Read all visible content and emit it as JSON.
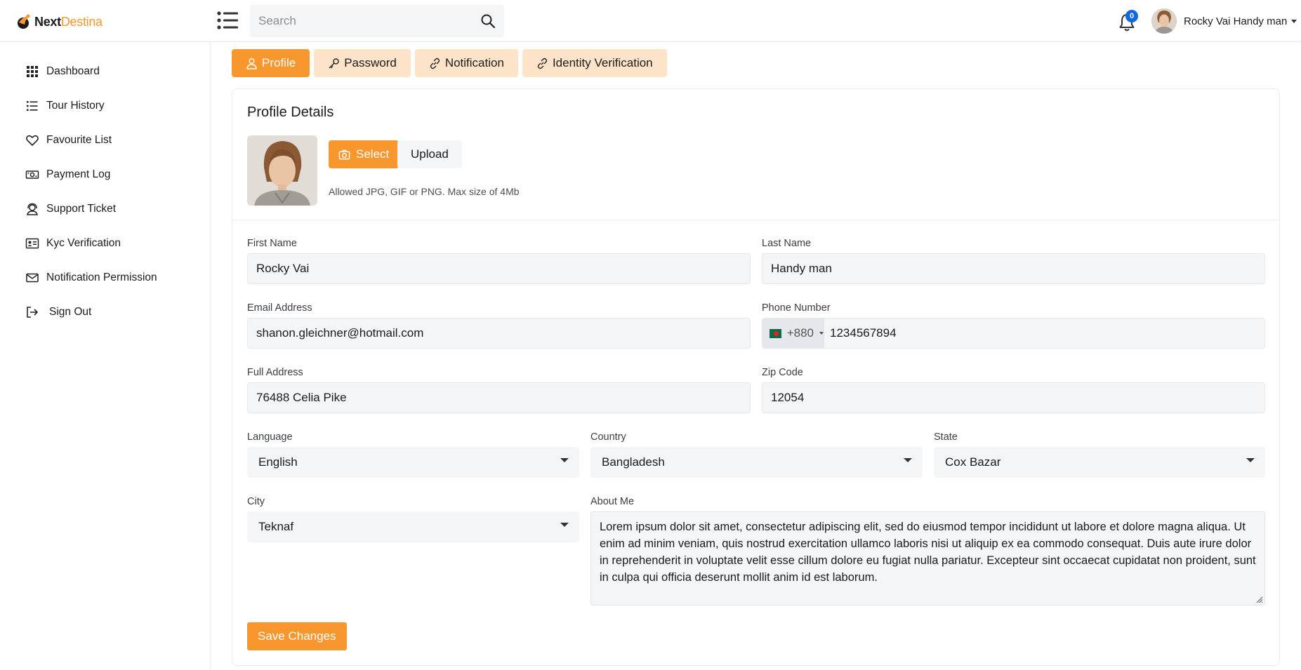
{
  "brand": {
    "name_part1": "Next",
    "name_part2": "Destina",
    "accent": "#f7972e"
  },
  "header": {
    "search_placeholder": "Search",
    "notification_count": "0",
    "user_name": "Rocky Vai Handy man"
  },
  "sidebar": {
    "items": [
      {
        "label": "Dashboard",
        "icon": "grid-icon"
      },
      {
        "label": "Tour History",
        "icon": "list-icon"
      },
      {
        "label": "Favourite List",
        "icon": "heart-icon"
      },
      {
        "label": "Payment Log",
        "icon": "cash-icon"
      },
      {
        "label": "Support Ticket",
        "icon": "headset-icon"
      },
      {
        "label": "Kyc Verification",
        "icon": "id-card-icon"
      },
      {
        "label": "Notification Permission",
        "icon": "envelope-icon"
      },
      {
        "label": "Sign Out",
        "icon": "sign-out-icon"
      }
    ]
  },
  "tabs": [
    {
      "label": "Profile",
      "icon": "person-icon",
      "active": true
    },
    {
      "label": "Password",
      "icon": "key-icon",
      "active": false
    },
    {
      "label": "Notification",
      "icon": "link-icon",
      "active": false
    },
    {
      "label": "Identity Verification",
      "icon": "link-icon",
      "active": false
    }
  ],
  "profile": {
    "title": "Profile Details",
    "select_label": "Select",
    "upload_label": "Upload",
    "hint": "Allowed JPG, GIF or PNG. Max size of 4Mb"
  },
  "form": {
    "first_name": {
      "label": "First Name",
      "value": "Rocky Vai"
    },
    "last_name": {
      "label": "Last Name",
      "value": "Handy man"
    },
    "email": {
      "label": "Email Address",
      "value": "shanon.gleichner@hotmail.com"
    },
    "phone": {
      "label": "Phone Number",
      "code": "+880",
      "value": "1234567894"
    },
    "address": {
      "label": "Full Address",
      "value": "76488 Celia Pike"
    },
    "zip": {
      "label": "Zip Code",
      "value": "12054"
    },
    "language": {
      "label": "Language",
      "value": "English"
    },
    "country": {
      "label": "Country",
      "value": "Bangladesh"
    },
    "state": {
      "label": "State",
      "value": "Cox Bazar"
    },
    "city": {
      "label": "City",
      "value": "Teknaf"
    },
    "about": {
      "label": "About Me",
      "value": "Lorem ipsum dolor sit amet, consectetur adipiscing elit, sed do eiusmod tempor incididunt ut labore et dolore magna aliqua. Ut enim ad minim veniam, quis nostrud exercitation ullamco laboris nisi ut aliquip ex ea commodo consequat. Duis aute irure dolor in reprehenderit in voluptate velit esse cillum dolore eu fugiat nulla pariatur. Excepteur sint occaecat cupidatat non proident, sunt in culpa qui officia deserunt mollit anim id est laborum."
    },
    "save_label": "Save Changes"
  }
}
